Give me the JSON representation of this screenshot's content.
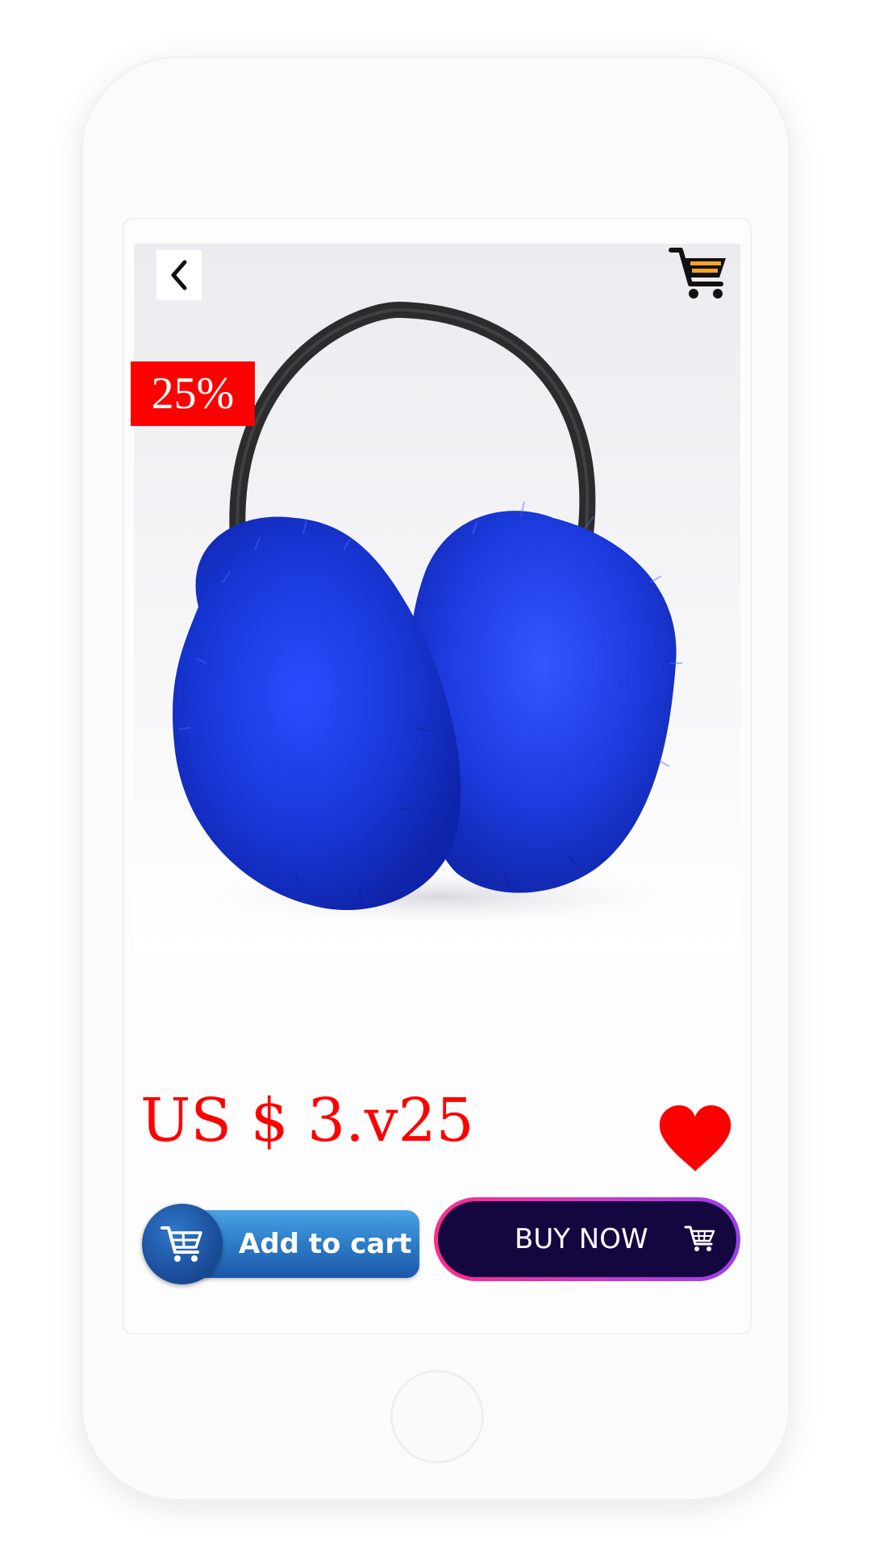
{
  "product": {
    "discount_badge": "25%",
    "price": "US $ 3.v25",
    "image_subject": "blue fur earmuffs"
  },
  "actions": {
    "add_to_cart_label": "Add to cart",
    "buy_now_label": "BUY NOW"
  },
  "icons": {
    "back": "chevron-left-icon",
    "cart": "shopping-cart-icon",
    "favorite": "heart-icon"
  },
  "colors": {
    "price": "#ff0000",
    "discount_badge_bg": "#ff0000",
    "heart": "#ff0000",
    "add_to_cart_bg": "#2f7fc9",
    "buy_now_bg": "#14063f",
    "buy_now_border": "#c43bd0",
    "earmuff_fur": "#1f3fe0"
  }
}
